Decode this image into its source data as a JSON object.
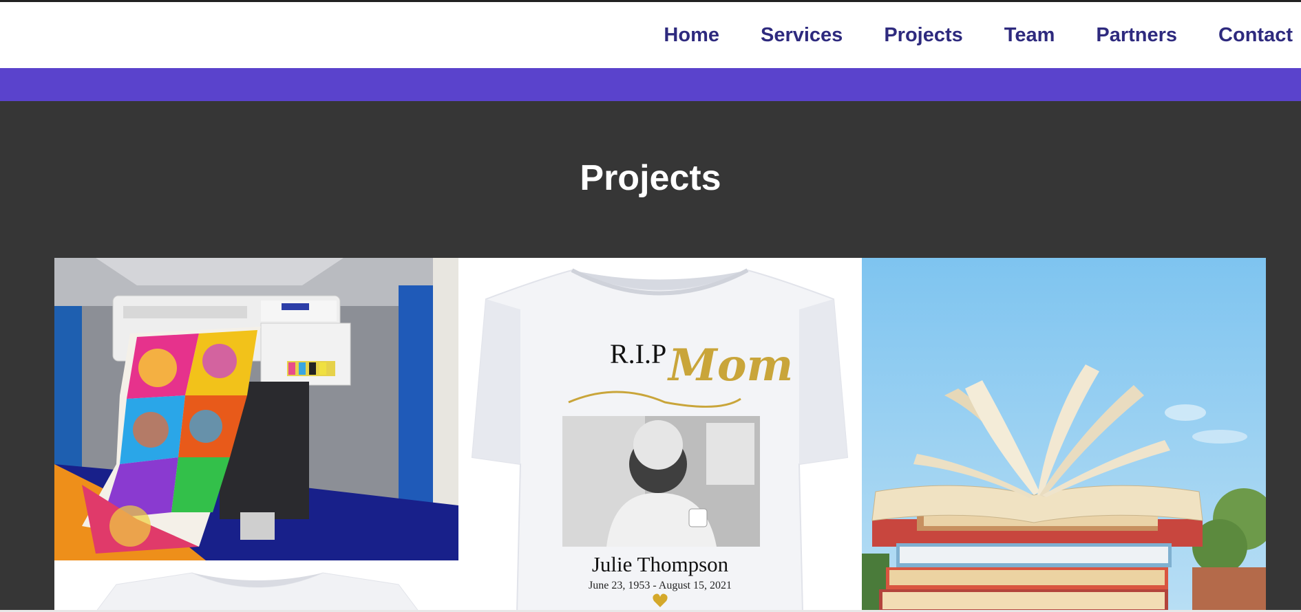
{
  "nav": {
    "items": [
      {
        "label": "Home"
      },
      {
        "label": "Services"
      },
      {
        "label": "Projects"
      },
      {
        "label": "Team"
      },
      {
        "label": "Partners"
      },
      {
        "label": "Contact"
      }
    ]
  },
  "projects": {
    "title": "Projects",
    "gallery": [
      {
        "image": "large-format-printer-photo"
      },
      {
        "image": "memorial-tshirt-photo",
        "print": {
          "line1": "R.I.P",
          "line2": "Mom",
          "name": "Julie Thompson",
          "dates": "June 23, 1953 - August 15, 2021"
        }
      },
      {
        "image": "stacked-books-photo"
      },
      {
        "image": "tshirt-photo-partial"
      }
    ]
  },
  "colors": {
    "nav_text": "#2e2a7e",
    "accent_band": "#5a43cc",
    "section_bg": "#363636",
    "gold": "#c9a53a"
  }
}
